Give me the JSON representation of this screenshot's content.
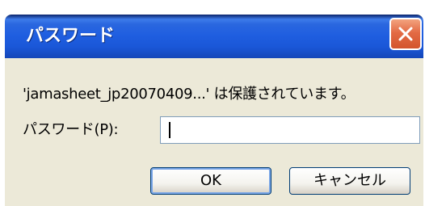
{
  "window": {
    "title": "パスワード"
  },
  "dialog": {
    "message": "'jamasheet_jp20070409...' は保護されています。",
    "password_label": "パスワード(P):",
    "password_value": ""
  },
  "buttons": {
    "ok": "OK",
    "cancel": "キャンセル"
  },
  "colors": {
    "titlebar": "#1f5ee0",
    "close_button": "#e36b45",
    "dialog_bg": "#ece9d8",
    "input_border": "#7f9db9"
  },
  "icons": {
    "close": "close-icon"
  }
}
